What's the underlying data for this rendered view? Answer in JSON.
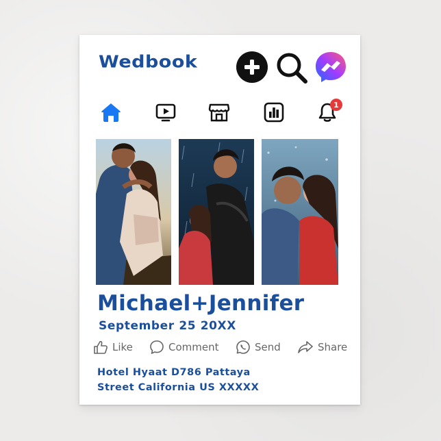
{
  "header": {
    "brand": "Wedbook"
  },
  "icons": {
    "create": "plus-icon",
    "search": "search-icon",
    "messenger": "messenger-icon"
  },
  "nav": {
    "items": [
      {
        "icon": "home-icon",
        "active": true
      },
      {
        "icon": "video-icon",
        "active": false
      },
      {
        "icon": "marketplace-icon",
        "active": false
      },
      {
        "icon": "stats-icon",
        "active": false
      },
      {
        "icon": "bell-icon",
        "active": false,
        "badge": "1"
      }
    ]
  },
  "photos": [
    {
      "subject": "couple embracing outdoors"
    },
    {
      "subject": "couple in the rain"
    },
    {
      "subject": "couple face to face in the rain"
    }
  ],
  "post": {
    "names": "Michael+Jennifer",
    "date": "September 25 20XX"
  },
  "actions": {
    "like": "Like",
    "comment": "Comment",
    "send": "Send",
    "share": "Share"
  },
  "address": {
    "line1": "Hotel Hyaat D786 Pattaya",
    "line2": "Street California US XXXXX"
  },
  "colors": {
    "brand": "#1b4f9c",
    "active_nav": "#1877f2",
    "badge": "#e53a3a"
  }
}
